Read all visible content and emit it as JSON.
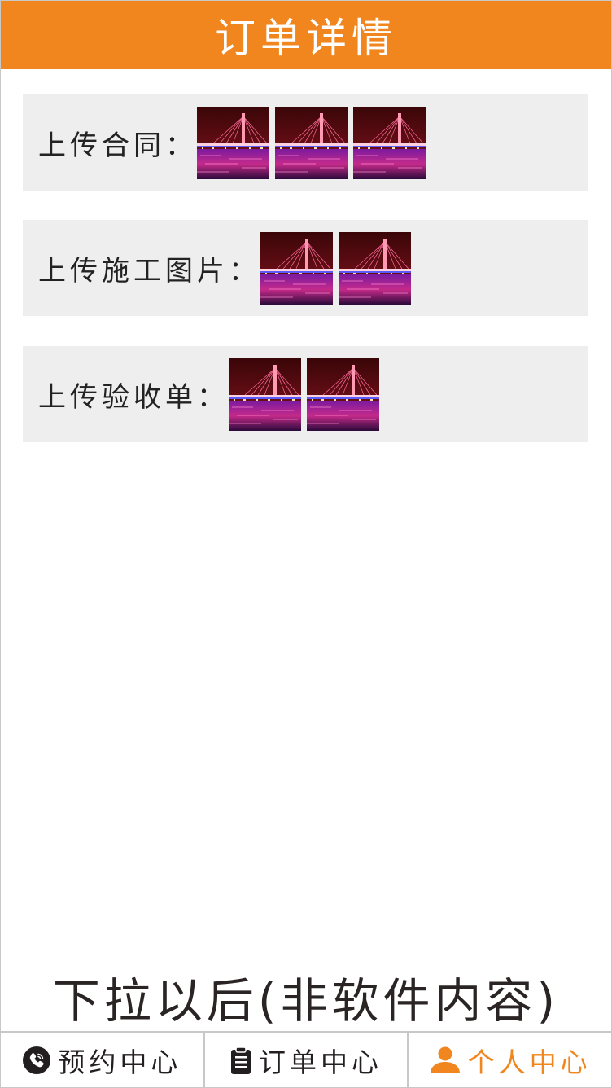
{
  "header": {
    "title": "订单详情"
  },
  "rows": [
    {
      "label": "上传合同：",
      "image_count": 3
    },
    {
      "label": "上传施工图片：",
      "image_count": 2
    },
    {
      "label": "上传验收单：",
      "image_count": 2
    }
  ],
  "note": "下拉以后(非软件内容)",
  "tabbar": {
    "items": [
      {
        "label": "预约中心",
        "icon": "phone-icon"
      },
      {
        "label": "订单中心",
        "icon": "clipboard-icon"
      },
      {
        "label": "个人中心",
        "icon": "user-icon",
        "active": true
      }
    ]
  },
  "colors": {
    "accent": "#f0861d",
    "row_bg": "#eeeeee",
    "text": "#231f20"
  }
}
